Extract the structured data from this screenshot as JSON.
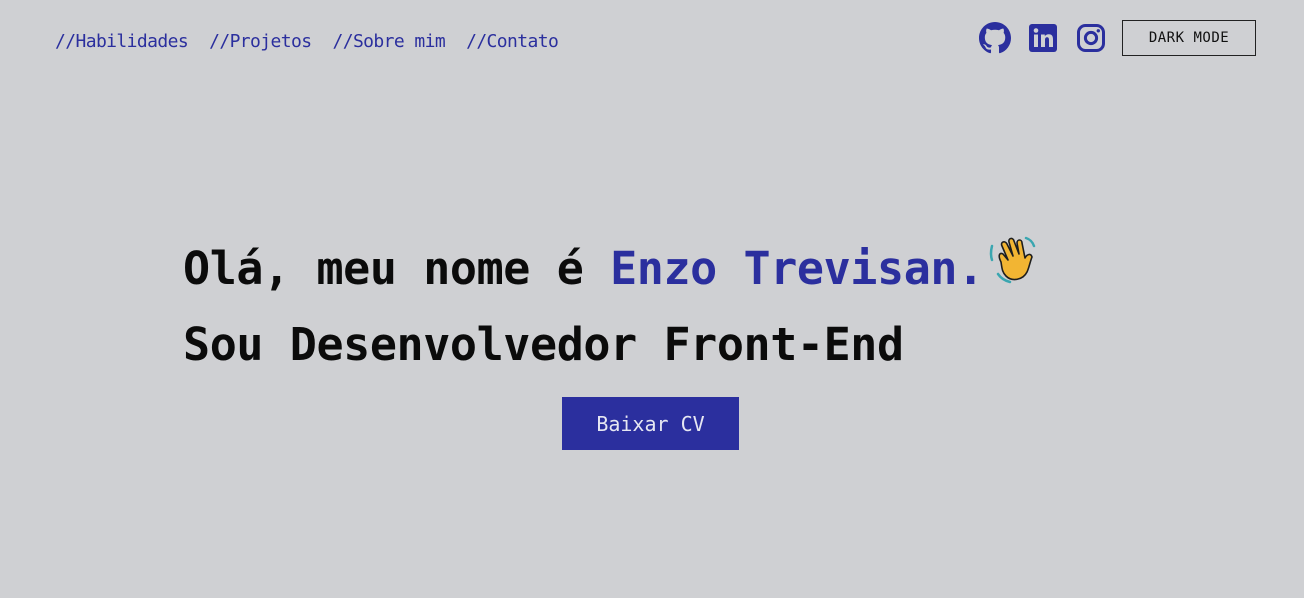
{
  "nav": {
    "items": [
      {
        "label": "//Habilidades"
      },
      {
        "label": "//Projetos"
      },
      {
        "label": "//Sobre mim"
      },
      {
        "label": "//Contato"
      }
    ]
  },
  "socials": {
    "icons": [
      "github-icon",
      "linkedin-icon",
      "instagram-icon"
    ],
    "color": "#2b2f9e"
  },
  "theme_toggle": {
    "label": "DARK MODE"
  },
  "hero": {
    "greeting": "Olá, meu nome é ",
    "name": "Enzo Trevisan.",
    "emoji": "waving-hand-icon",
    "subtitle": "Sou Desenvolvedor Front-End"
  },
  "cta": {
    "label": "Baixar CV"
  },
  "colors": {
    "background": "#cfd0d3",
    "accent": "#2b2f9e",
    "text": "#0b0b0b"
  }
}
